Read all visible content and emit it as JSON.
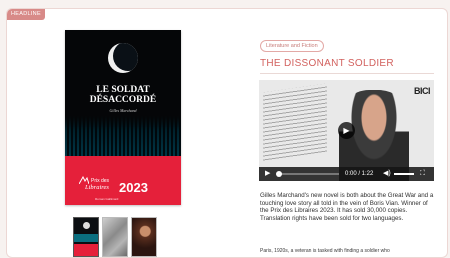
{
  "headline_tag": "HEADLINE",
  "book": {
    "title_line1": "LE SOLDAT",
    "title_line2": "DÉSACCORDÉ",
    "author": "Gilles Marchand",
    "prize_line1": "Prix des",
    "prize_line2": "Libraires",
    "prize_year": "2023",
    "prize_sub": "Roman  Gallimard",
    "colors": {
      "cover": "#050608",
      "band": "#0b7c8c",
      "prize": "#e5203a"
    }
  },
  "thumbnails": [
    "book-cover",
    "soldiers-photo",
    "author-portrait"
  ],
  "category_tag": "Literature and Fiction",
  "title": "THE DISSONANT SOLDIER",
  "video": {
    "logo": "BICI",
    "time": "0:00 / 1:22",
    "progress": 0.0
  },
  "description": "Gilles Marchand's new novel is both about the Great War and a touching love story all told in the vein of Boris Vian. Winner of the Prix des Libraires 2023. It has sold 30,000 copies. Translation rights have been sold for two languages.",
  "description_more": "Paris, 1920s, a veteran is tasked with finding a soldier who",
  "accent_color": "#d2615e"
}
